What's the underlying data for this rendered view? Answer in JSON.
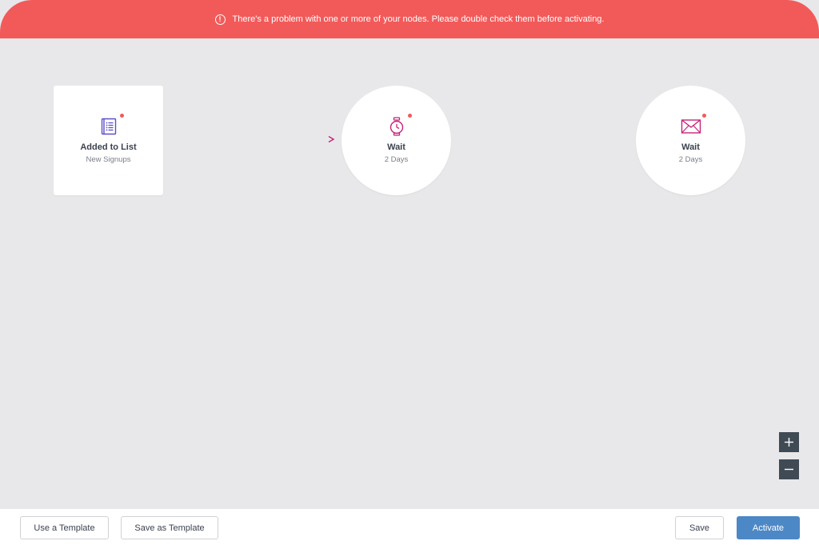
{
  "banner": {
    "message": "There's a problem with one or more of your nodes. Please double check them before activating.",
    "icon": "alert-circle-icon",
    "color": "#f25a5a"
  },
  "nodes": [
    {
      "title": "Added to List",
      "subtitle": "New Signups",
      "icon": "list-icon",
      "shape": "square",
      "has_error": true
    },
    {
      "title": "Wait",
      "subtitle": "2 Days",
      "icon": "stopwatch-icon",
      "shape": "circle",
      "has_error": true
    },
    {
      "title": "Wait",
      "subtitle": "2 Days",
      "icon": "envelope-icon",
      "shape": "circle",
      "has_error": true
    }
  ],
  "zoom": {
    "in_label": "+",
    "out_label": "−"
  },
  "footer": {
    "use_template": "Use a Template",
    "save_as_template": "Save as Template",
    "save": "Save",
    "activate": "Activate"
  },
  "colors": {
    "error": "#f25a5a",
    "primary": "#4d88c6",
    "icon_purple": "#5b4fc9",
    "icon_pink": "#c7237a",
    "canvas": "#e8e8ea"
  }
}
